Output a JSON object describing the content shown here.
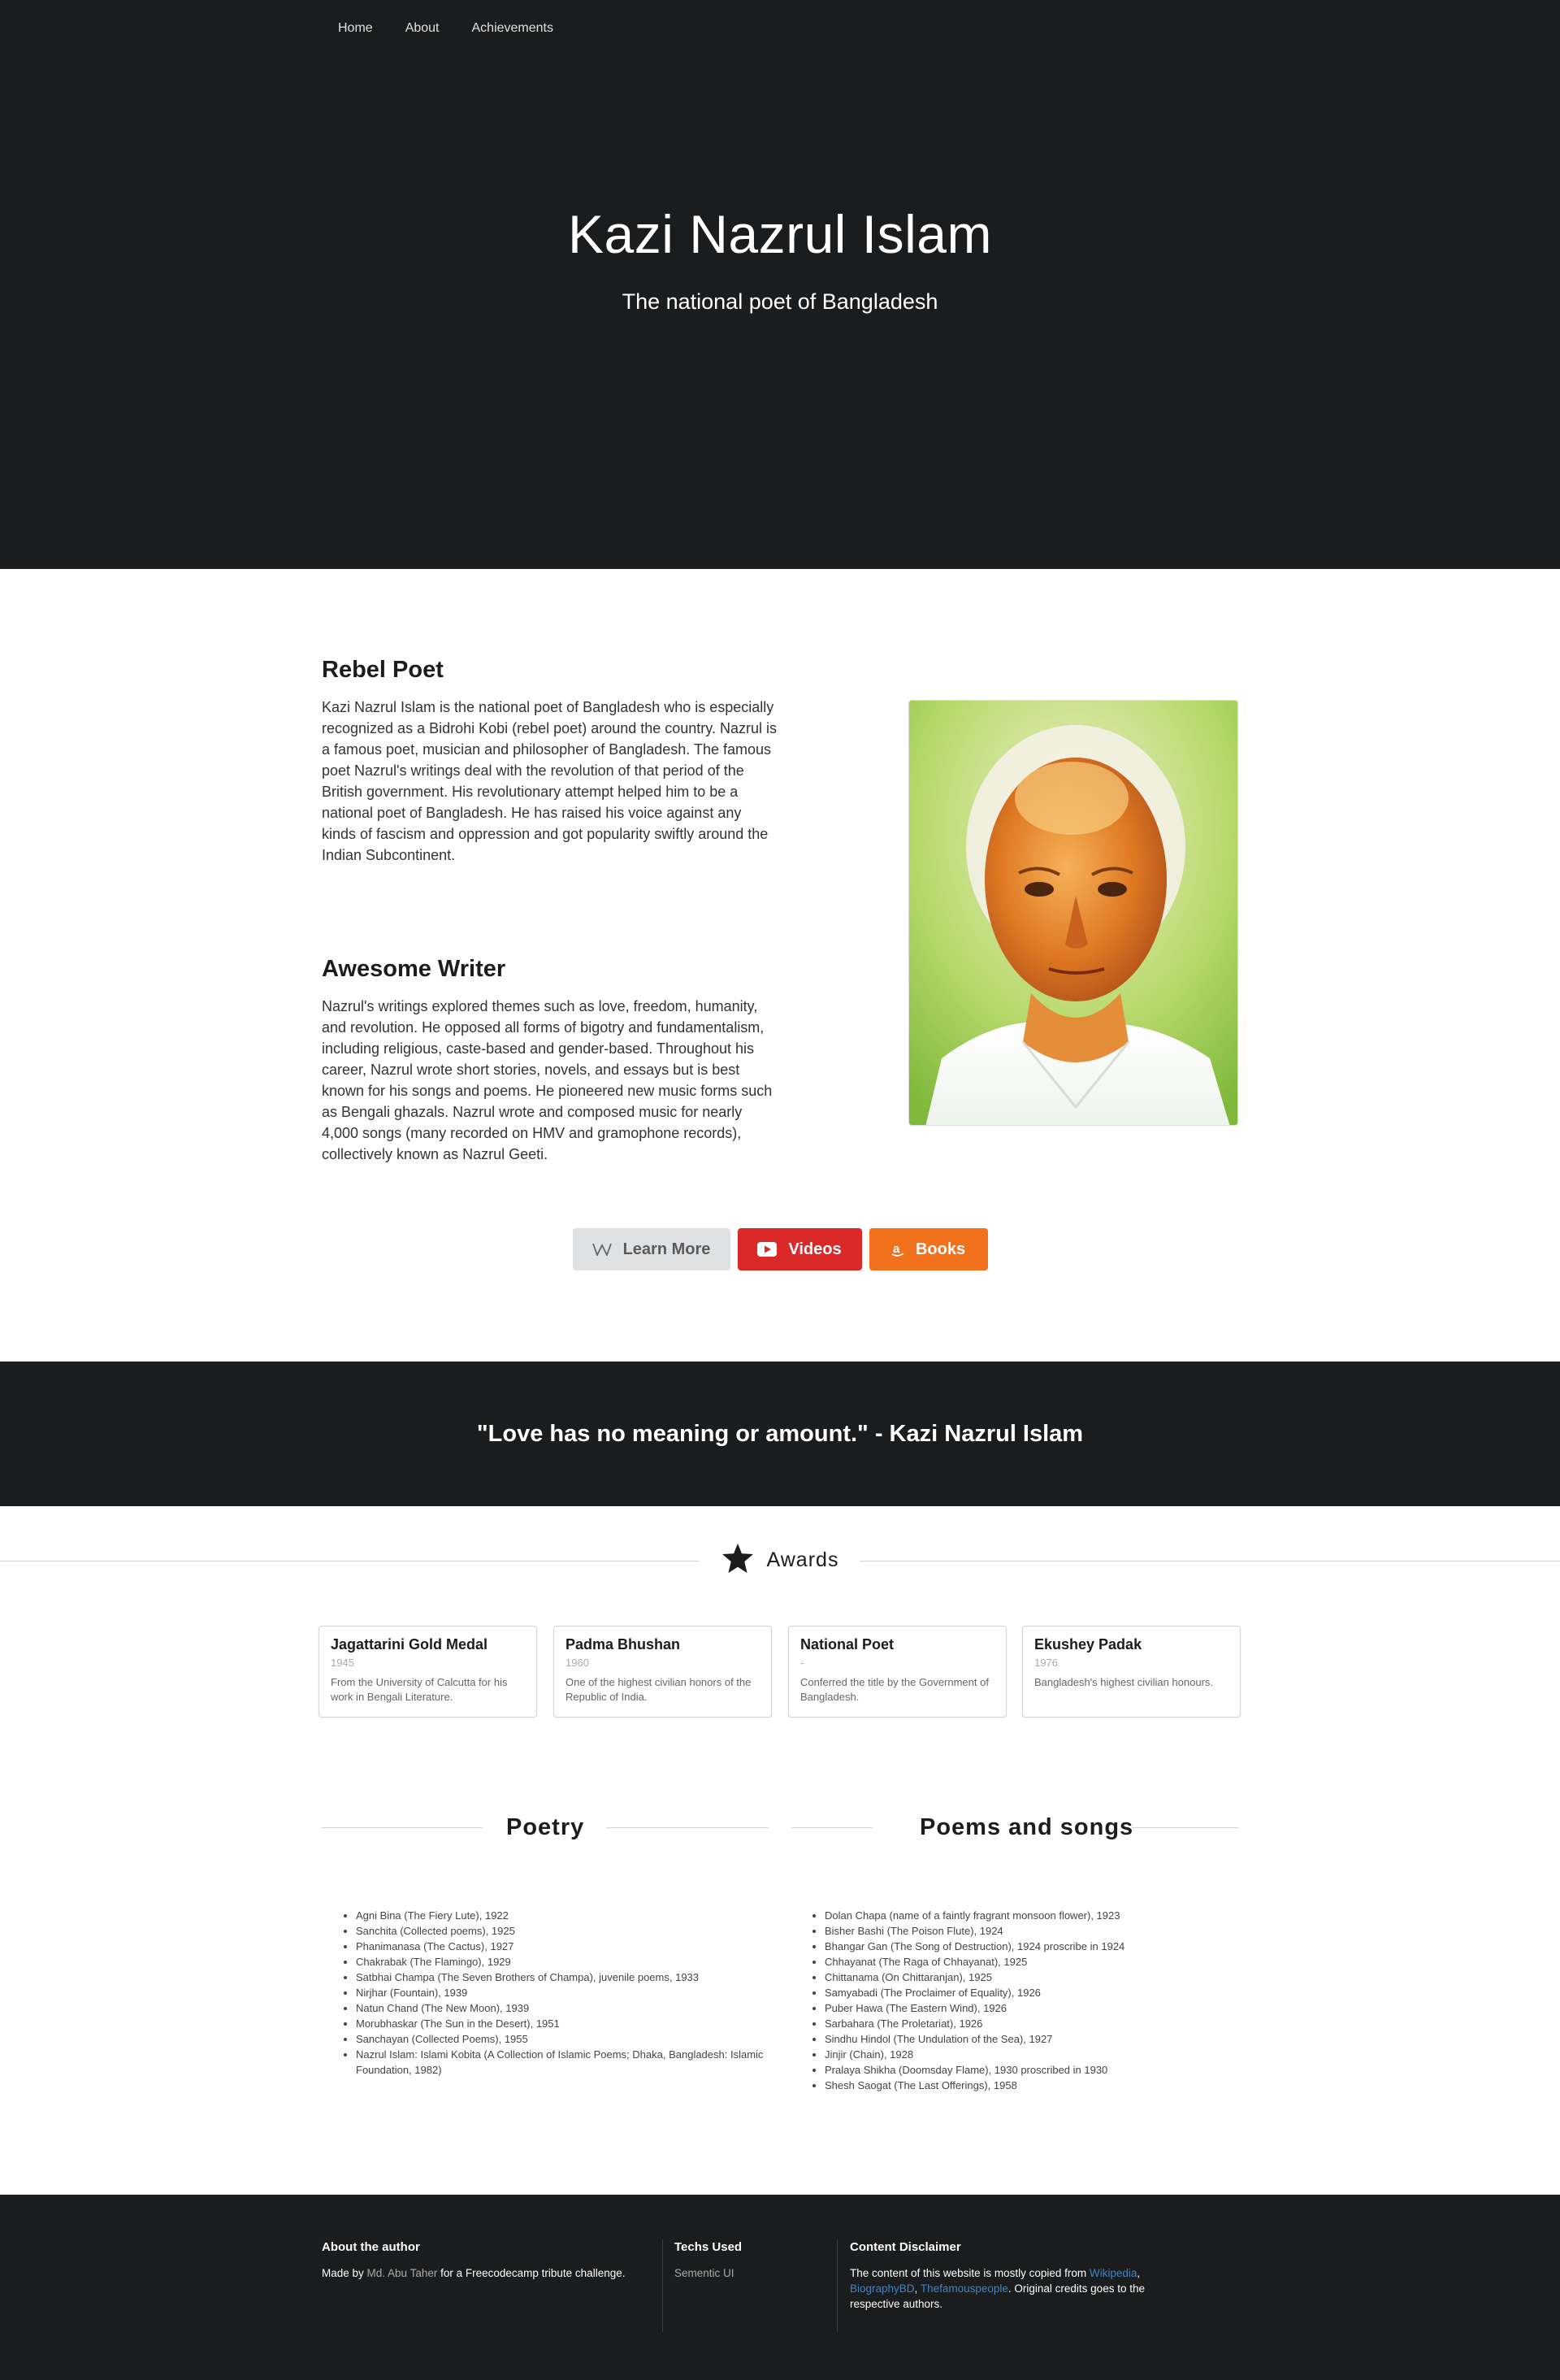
{
  "nav": {
    "items": [
      "Home",
      "About",
      "Achievements"
    ]
  },
  "hero": {
    "title": "Kazi Nazrul Islam",
    "subtitle": "The national poet of Bangladesh"
  },
  "intro": {
    "section1": {
      "title": "Rebel Poet",
      "text": "Kazi Nazrul Islam is the national poet of Bangladesh who is especially recognized as a Bidrohi Kobi (rebel poet) around the country. Nazrul is a famous poet, musician and philosopher of Bangladesh. The famous poet Nazrul's writings deal with the revolution of that period of the British government. His revolutionary attempt helped him to be a national poet of Bangladesh. He has raised his voice against any kinds of fascism and oppression and got popularity swiftly around the Indian Subcontinent."
    },
    "section2": {
      "title": "Awesome Writer",
      "text": "Nazrul's writings explored themes such as love, freedom, humanity, and revolution. He opposed all forms of bigotry and fundamentalism, including religious, caste-based and gender-based. Throughout his career, Nazrul wrote short stories, novels, and essays but is best known for his songs and poems. He pioneered new music forms such as Bengali ghazals. Nazrul wrote and composed music for nearly 4,000 songs (many recorded on HMV and gramophone records), collectively known as Nazrul Geeti."
    }
  },
  "buttons": {
    "learn_more": "Learn More",
    "videos": "Videos",
    "books": "Books"
  },
  "quote": "\"Love has no meaning or amount.\" - Kazi Nazrul Islam",
  "awards": {
    "heading": "Awards",
    "items": [
      {
        "title": "Jagattarini Gold Medal",
        "meta": "1945",
        "desc": "From the University of Calcutta for his work in Bengali Literature."
      },
      {
        "title": "Padma Bhushan",
        "meta": "1960",
        "desc": "One of the highest civilian honors of the Republic of India."
      },
      {
        "title": "National Poet",
        "meta": "-",
        "desc": "Conferred the title by the Government of Bangladesh."
      },
      {
        "title": "Ekushey Padak",
        "meta": "1976",
        "desc": "Bangladesh's highest civilian honours."
      }
    ]
  },
  "poetry": {
    "heading": "Poetry",
    "items": [
      "Agni Bina (The Fiery Lute), 1922",
      "Sanchita (Collected poems), 1925",
      "Phanimanasa (The Cactus), 1927",
      "Chakrabak (The Flamingo), 1929",
      "Satbhai Champa (The Seven Brothers of Champa), juvenile poems, 1933",
      "Nirjhar (Fountain), 1939",
      "Natun Chand (The New Moon), 1939",
      "Morubhaskar (The Sun in the Desert), 1951",
      "Sanchayan (Collected Poems), 1955",
      "Nazrul Islam: Islami Kobita (A Collection of Islamic Poems; Dhaka, Bangladesh: Islamic Foundation, 1982)"
    ]
  },
  "songs": {
    "heading": "Poems and songs",
    "items": [
      "Dolan Chapa (name of a faintly fragrant monsoon flower), 1923",
      "Bisher Bashi (The Poison Flute), 1924",
      "Bhangar Gan (The Song of Destruction), 1924 proscribe in 1924",
      "Chhayanat (The Raga of Chhayanat), 1925",
      "Chittanama (On Chittaranjan), 1925",
      "Samyabadi (The Proclaimer of Equality), 1926",
      "Puber Hawa (The Eastern Wind), 1926",
      "Sarbahara (The Proletariat), 1926",
      "Sindhu Hindol (The Undulation of the Sea), 1927",
      "Jinjir (Chain), 1928",
      "Pralaya Shikha (Doomsday Flame), 1930 proscribed in 1930",
      "Shesh Saogat (The Last Offerings), 1958"
    ]
  },
  "footer": {
    "about": {
      "heading": "About the author",
      "made_by": "Made by ",
      "author": "Md. Abu Taher",
      "suffix": " for a Freecodecamp tribute challenge."
    },
    "techs": {
      "heading": "Techs Used",
      "item": "Sementic UI"
    },
    "disclaimer": {
      "heading": "Content Disclaimer",
      "prefix": "The content of this website is mostly copied from ",
      "link1": "Wikipedia",
      "comma1": ", ",
      "link2": "BiographyBD",
      "comma2": ", ",
      "link3": "Thefamouspeople",
      "suffix": ". Original credits goes to the respective authors."
    }
  },
  "colors": {
    "dark": "#1b1c1d",
    "red": "#db2828",
    "orange": "#f2711c",
    "link": "#4183c4"
  }
}
